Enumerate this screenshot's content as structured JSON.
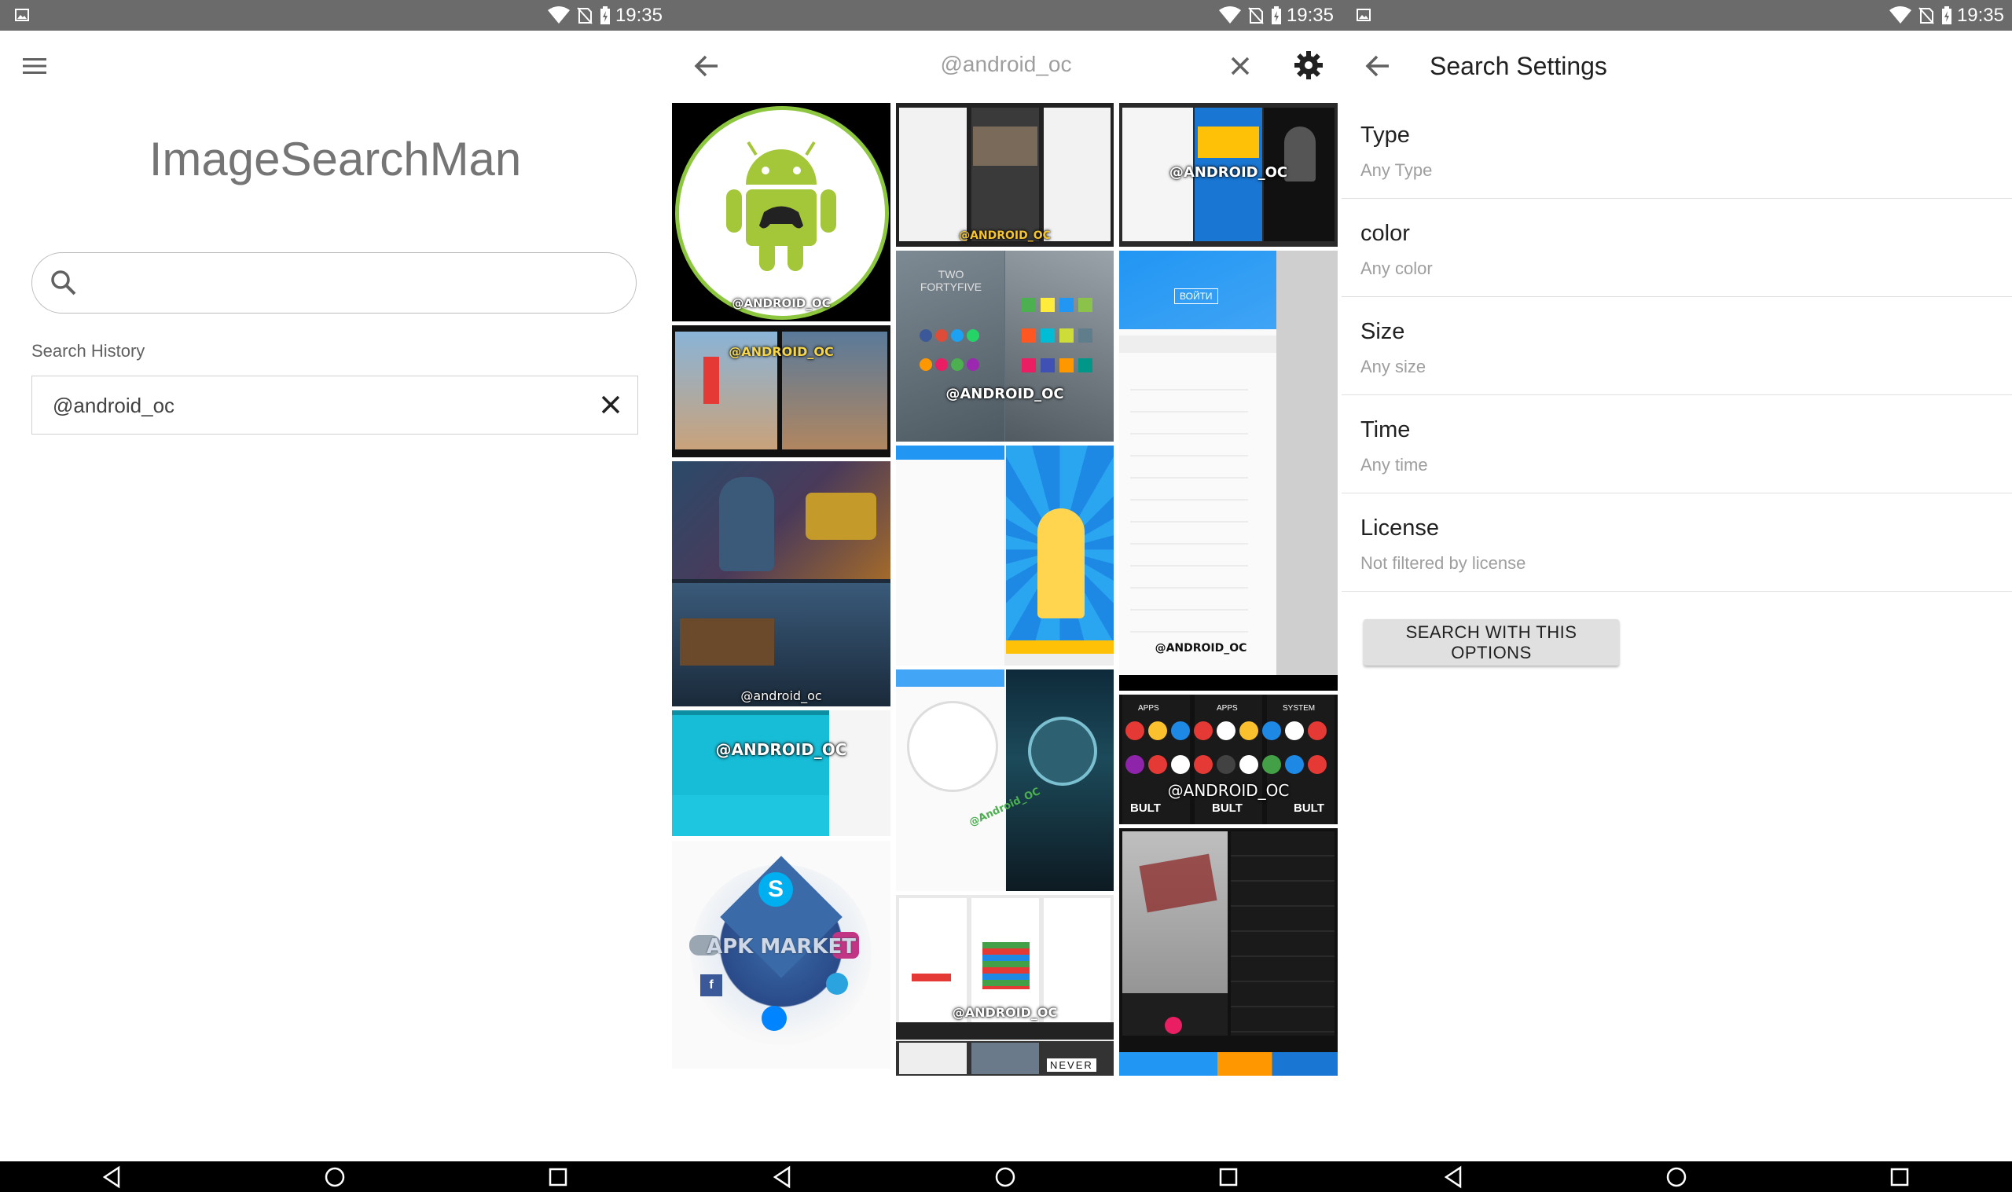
{
  "status_bar": {
    "time": "19:35",
    "icons": [
      "image-notification-icon",
      "wifi-icon",
      "no-sim-icon",
      "battery-charging-icon"
    ]
  },
  "home": {
    "app_title": "ImageSearchMan",
    "search_placeholder": "",
    "history_label": "Search History",
    "history": [
      {
        "query": "@android_oc"
      }
    ]
  },
  "results": {
    "query": "@android_oc",
    "tiles": [
      {
        "watermark": "@ANDROID_OC"
      },
      {
        "watermark": "@ANDROID_OC"
      },
      {
        "watermark": "@ANDROID_OC"
      },
      {
        "watermark": "@ANDROID_OC"
      },
      {
        "watermark": "@ANDROID_OC"
      },
      {
        "watermark": "@android_oc"
      },
      {
        "watermark": "@ANDROID_OC"
      },
      {
        "watermark": "@Android_OC"
      },
      {
        "watermark": "@ANDROID_OC"
      },
      {
        "watermark": "APK MARKET"
      },
      {
        "watermark": "@ANDROID_OC"
      },
      {
        "watermark": "NEVER"
      }
    ],
    "tile_texts": {
      "twofortyfive": "TWO\nFORTYFIVE",
      "bult": [
        "BULT",
        "BULT",
        "BULT"
      ],
      "apps": [
        "APPS",
        "APPS",
        "SYSTEM"
      ],
      "voyti": "ВОЙТИ"
    }
  },
  "settings": {
    "title": "Search Settings",
    "items": [
      {
        "name": "Type",
        "value": "Any Type"
      },
      {
        "name": "color",
        "value": "Any color"
      },
      {
        "name": "Size",
        "value": "Any size"
      },
      {
        "name": "Time",
        "value": "Any time"
      },
      {
        "name": "License",
        "value": "Not filtered by license"
      }
    ],
    "button_label": "SEARCH WITH THIS OPTIONS"
  },
  "colors": {
    "status_bar": "#6b6b6b",
    "nav_bar": "#000000",
    "android_green": "#a4c639"
  }
}
